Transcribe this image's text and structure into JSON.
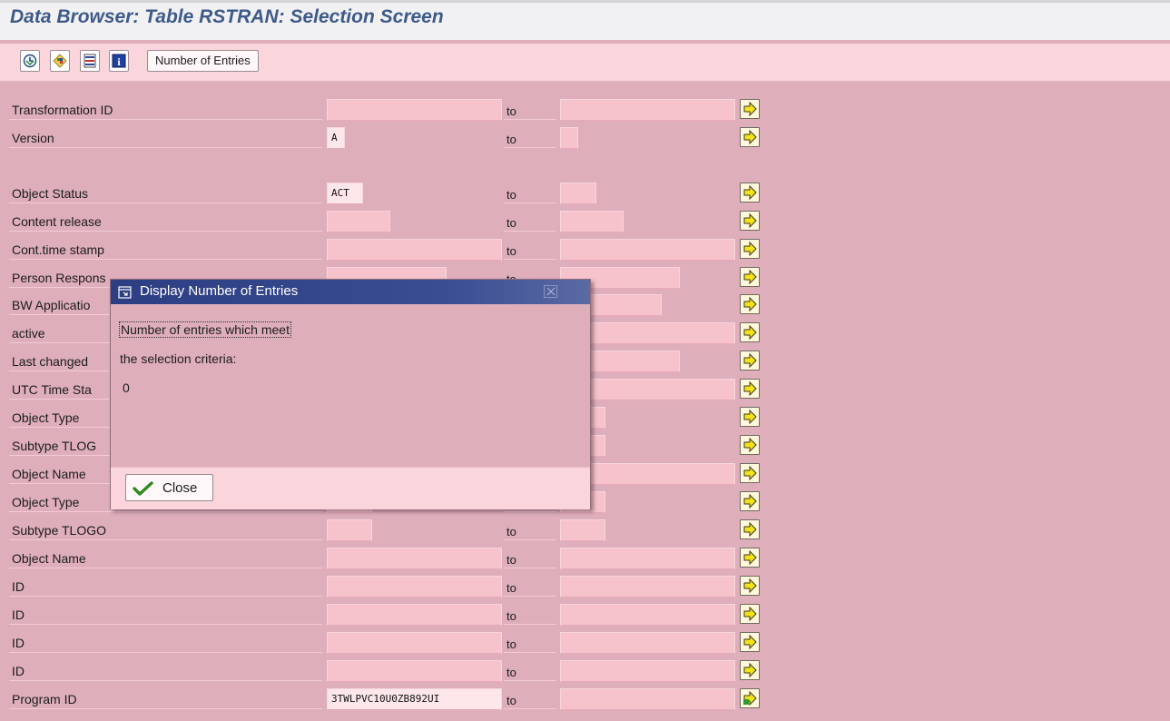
{
  "title": "Data Browser: Table RSTRAN: Selection Screen",
  "toolbar": {
    "buttons": [
      {
        "icon": "execute-icon"
      },
      {
        "icon": "selection-options-icon"
      },
      {
        "icon": "delete-row-icon"
      },
      {
        "icon": "information-icon"
      }
    ],
    "number_of_entries_label": "Number of Entries"
  },
  "to_label": "to",
  "rows": [
    {
      "label": "Transformation ID",
      "low": "",
      "high": ""
    },
    {
      "label": "Version",
      "low": "A",
      "high": ""
    },
    {
      "label": "Object Status",
      "low": "ACT",
      "high": ""
    },
    {
      "label": "Content release",
      "low": "",
      "high": ""
    },
    {
      "label": "Cont.time stamp",
      "low": "",
      "high": ""
    },
    {
      "label": "Person Respons",
      "low": "",
      "high": ""
    },
    {
      "label": "BW Applicatio",
      "low": "",
      "high": ""
    },
    {
      "label": "active",
      "low": "",
      "high": ""
    },
    {
      "label": "Last changed",
      "low": "",
      "high": ""
    },
    {
      "label": "UTC Time Sta",
      "low": "",
      "high": ""
    },
    {
      "label": "Object Type",
      "low": "",
      "high": ""
    },
    {
      "label": "Subtype TLOG",
      "low": "",
      "high": ""
    },
    {
      "label": "Object Name",
      "low": "",
      "high": ""
    },
    {
      "label": "Object Type",
      "low": "",
      "high": ""
    },
    {
      "label": "Subtype TLOGO",
      "low": "",
      "high": ""
    },
    {
      "label": "Object Name",
      "low": "",
      "high": ""
    },
    {
      "label": "ID",
      "low": "",
      "high": ""
    },
    {
      "label": "ID",
      "low": "",
      "high": ""
    },
    {
      "label": "ID",
      "low": "",
      "high": ""
    },
    {
      "label": "ID",
      "low": "",
      "high": ""
    },
    {
      "label": "Program ID",
      "low": "3TWLPVC10U0ZB892UI",
      "high": ""
    }
  ],
  "dialog": {
    "title": "Display Number of Entries",
    "message_line1": "Number of entries which meet",
    "message_line2": "the selection criteria:",
    "count": "0",
    "close_label": "Close"
  },
  "colors": {
    "background": "#deaebb",
    "toolbar": "#fbd5dc",
    "title_text": "#3e5a89",
    "dialog_header": "#2d3e82",
    "input_field": "#f6c3cd",
    "filled_field": "#fde7eb"
  }
}
